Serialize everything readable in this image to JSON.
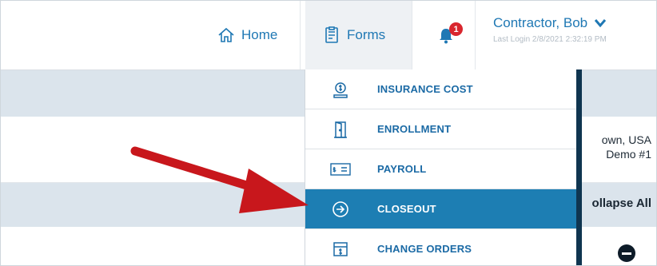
{
  "header": {
    "home_label": "Home",
    "forms_label": "Forms",
    "notification_count": "1",
    "user_name": "Contractor, Bob",
    "last_login": "Last Login 2/8/2021 2:32:19 PM"
  },
  "background": {
    "location_line1": "own, USA",
    "location_line2": "Demo #1",
    "collapse_all": "ollapse All"
  },
  "forms_menu": {
    "items": [
      {
        "label": "INSURANCE COST",
        "icon": "dollar-document-icon",
        "active": false
      },
      {
        "label": "ENROLLMENT",
        "icon": "door-icon",
        "active": false
      },
      {
        "label": "PAYROLL",
        "icon": "check-payment-icon",
        "active": false
      },
      {
        "label": "CLOSEOUT",
        "icon": "arrow-circle-right-icon",
        "active": true
      },
      {
        "label": "CHANGE ORDERS",
        "icon": "dollar-box-icon",
        "active": false
      }
    ]
  },
  "colors": {
    "accent": "#1f78b4",
    "active_item_bg": "#1d7eb3",
    "annotation_arrow": "#c8171c",
    "badge": "#d9262e"
  }
}
